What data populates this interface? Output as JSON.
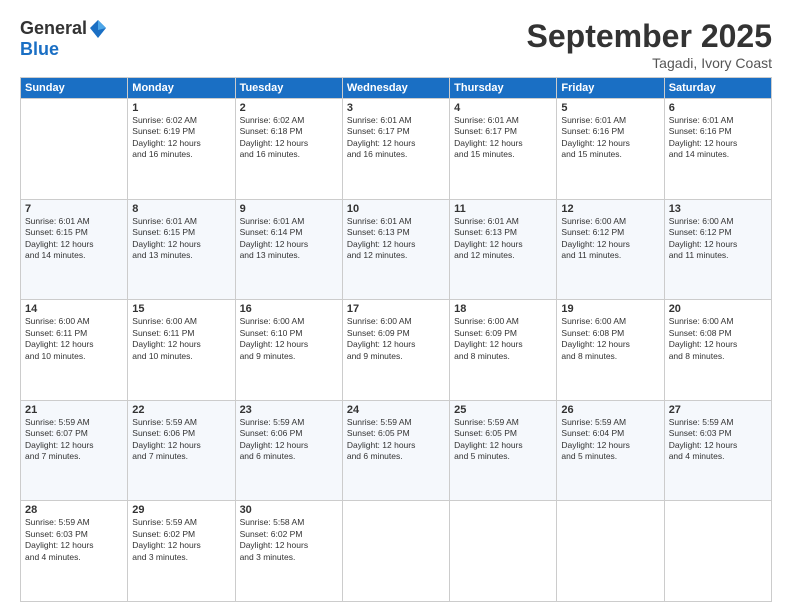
{
  "logo": {
    "general": "General",
    "blue": "Blue"
  },
  "title": "September 2025",
  "location": "Tagadi, Ivory Coast",
  "weekdays": [
    "Sunday",
    "Monday",
    "Tuesday",
    "Wednesday",
    "Thursday",
    "Friday",
    "Saturday"
  ],
  "weeks": [
    [
      {
        "day": "",
        "detail": ""
      },
      {
        "day": "1",
        "detail": "Sunrise: 6:02 AM\nSunset: 6:19 PM\nDaylight: 12 hours\nand 16 minutes."
      },
      {
        "day": "2",
        "detail": "Sunrise: 6:02 AM\nSunset: 6:18 PM\nDaylight: 12 hours\nand 16 minutes."
      },
      {
        "day": "3",
        "detail": "Sunrise: 6:01 AM\nSunset: 6:17 PM\nDaylight: 12 hours\nand 16 minutes."
      },
      {
        "day": "4",
        "detail": "Sunrise: 6:01 AM\nSunset: 6:17 PM\nDaylight: 12 hours\nand 15 minutes."
      },
      {
        "day": "5",
        "detail": "Sunrise: 6:01 AM\nSunset: 6:16 PM\nDaylight: 12 hours\nand 15 minutes."
      },
      {
        "day": "6",
        "detail": "Sunrise: 6:01 AM\nSunset: 6:16 PM\nDaylight: 12 hours\nand 14 minutes."
      }
    ],
    [
      {
        "day": "7",
        "detail": "Sunrise: 6:01 AM\nSunset: 6:15 PM\nDaylight: 12 hours\nand 14 minutes."
      },
      {
        "day": "8",
        "detail": "Sunrise: 6:01 AM\nSunset: 6:15 PM\nDaylight: 12 hours\nand 13 minutes."
      },
      {
        "day": "9",
        "detail": "Sunrise: 6:01 AM\nSunset: 6:14 PM\nDaylight: 12 hours\nand 13 minutes."
      },
      {
        "day": "10",
        "detail": "Sunrise: 6:01 AM\nSunset: 6:13 PM\nDaylight: 12 hours\nand 12 minutes."
      },
      {
        "day": "11",
        "detail": "Sunrise: 6:01 AM\nSunset: 6:13 PM\nDaylight: 12 hours\nand 12 minutes."
      },
      {
        "day": "12",
        "detail": "Sunrise: 6:00 AM\nSunset: 6:12 PM\nDaylight: 12 hours\nand 11 minutes."
      },
      {
        "day": "13",
        "detail": "Sunrise: 6:00 AM\nSunset: 6:12 PM\nDaylight: 12 hours\nand 11 minutes."
      }
    ],
    [
      {
        "day": "14",
        "detail": "Sunrise: 6:00 AM\nSunset: 6:11 PM\nDaylight: 12 hours\nand 10 minutes."
      },
      {
        "day": "15",
        "detail": "Sunrise: 6:00 AM\nSunset: 6:11 PM\nDaylight: 12 hours\nand 10 minutes."
      },
      {
        "day": "16",
        "detail": "Sunrise: 6:00 AM\nSunset: 6:10 PM\nDaylight: 12 hours\nand 9 minutes."
      },
      {
        "day": "17",
        "detail": "Sunrise: 6:00 AM\nSunset: 6:09 PM\nDaylight: 12 hours\nand 9 minutes."
      },
      {
        "day": "18",
        "detail": "Sunrise: 6:00 AM\nSunset: 6:09 PM\nDaylight: 12 hours\nand 8 minutes."
      },
      {
        "day": "19",
        "detail": "Sunrise: 6:00 AM\nSunset: 6:08 PM\nDaylight: 12 hours\nand 8 minutes."
      },
      {
        "day": "20",
        "detail": "Sunrise: 6:00 AM\nSunset: 6:08 PM\nDaylight: 12 hours\nand 8 minutes."
      }
    ],
    [
      {
        "day": "21",
        "detail": "Sunrise: 5:59 AM\nSunset: 6:07 PM\nDaylight: 12 hours\nand 7 minutes."
      },
      {
        "day": "22",
        "detail": "Sunrise: 5:59 AM\nSunset: 6:06 PM\nDaylight: 12 hours\nand 7 minutes."
      },
      {
        "day": "23",
        "detail": "Sunrise: 5:59 AM\nSunset: 6:06 PM\nDaylight: 12 hours\nand 6 minutes."
      },
      {
        "day": "24",
        "detail": "Sunrise: 5:59 AM\nSunset: 6:05 PM\nDaylight: 12 hours\nand 6 minutes."
      },
      {
        "day": "25",
        "detail": "Sunrise: 5:59 AM\nSunset: 6:05 PM\nDaylight: 12 hours\nand 5 minutes."
      },
      {
        "day": "26",
        "detail": "Sunrise: 5:59 AM\nSunset: 6:04 PM\nDaylight: 12 hours\nand 5 minutes."
      },
      {
        "day": "27",
        "detail": "Sunrise: 5:59 AM\nSunset: 6:03 PM\nDaylight: 12 hours\nand 4 minutes."
      }
    ],
    [
      {
        "day": "28",
        "detail": "Sunrise: 5:59 AM\nSunset: 6:03 PM\nDaylight: 12 hours\nand 4 minutes."
      },
      {
        "day": "29",
        "detail": "Sunrise: 5:59 AM\nSunset: 6:02 PM\nDaylight: 12 hours\nand 3 minutes."
      },
      {
        "day": "30",
        "detail": "Sunrise: 5:58 AM\nSunset: 6:02 PM\nDaylight: 12 hours\nand 3 minutes."
      },
      {
        "day": "",
        "detail": ""
      },
      {
        "day": "",
        "detail": ""
      },
      {
        "day": "",
        "detail": ""
      },
      {
        "day": "",
        "detail": ""
      }
    ]
  ]
}
